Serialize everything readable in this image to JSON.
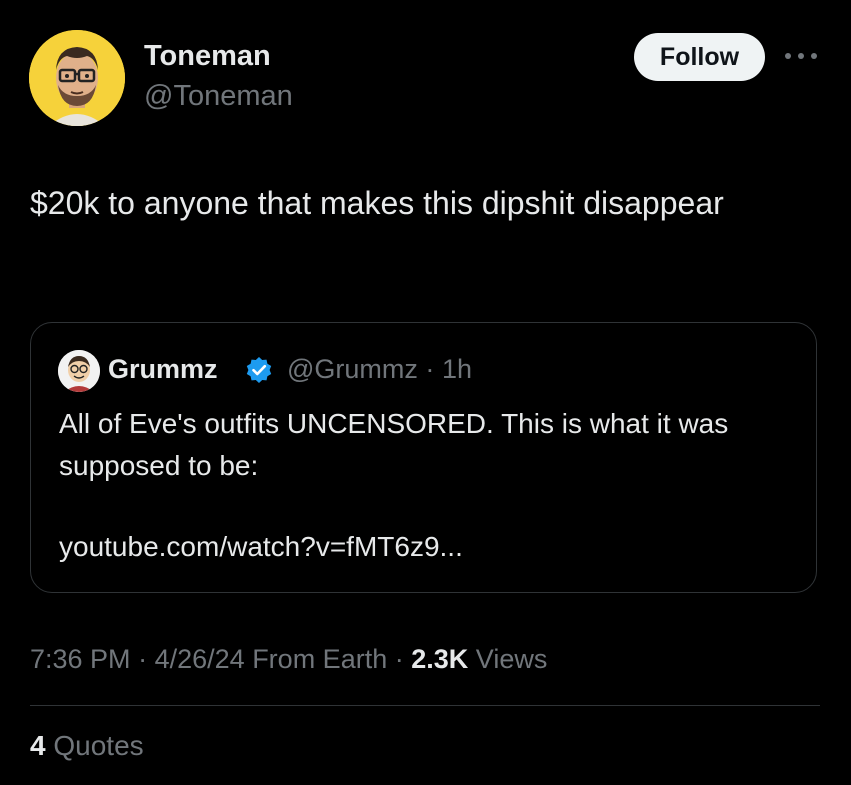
{
  "author": {
    "name": "Toneman",
    "handle": "@Toneman",
    "follow_label": "Follow"
  },
  "tweet": {
    "text": "$20k to anyone that makes this dipshit disappear"
  },
  "quoted": {
    "name": "Grummz",
    "handle": "@Grummz",
    "separator": "·",
    "time": "1h",
    "text": "All of Eve's outfits UNCENSORED. This is what it was supposed to be:",
    "link": "youtube.com/watch?v=fMT6z9..."
  },
  "meta": {
    "time": "7:36 PM",
    "date": "4/26/24",
    "location": "From Earth",
    "views_count": "2.3K",
    "views_label": "Views"
  },
  "engagement": {
    "quotes_count": "4",
    "quotes_label": "Quotes"
  },
  "icons": {
    "more": "more-horizontal-icon",
    "verified": "verified-badge-icon"
  },
  "colors": {
    "background": "#000000",
    "text_primary": "#e7e9ea",
    "text_secondary": "#71767b",
    "verified": "#1d9bf0",
    "border": "#2f3336",
    "avatar_bg": "#f6d23a"
  }
}
